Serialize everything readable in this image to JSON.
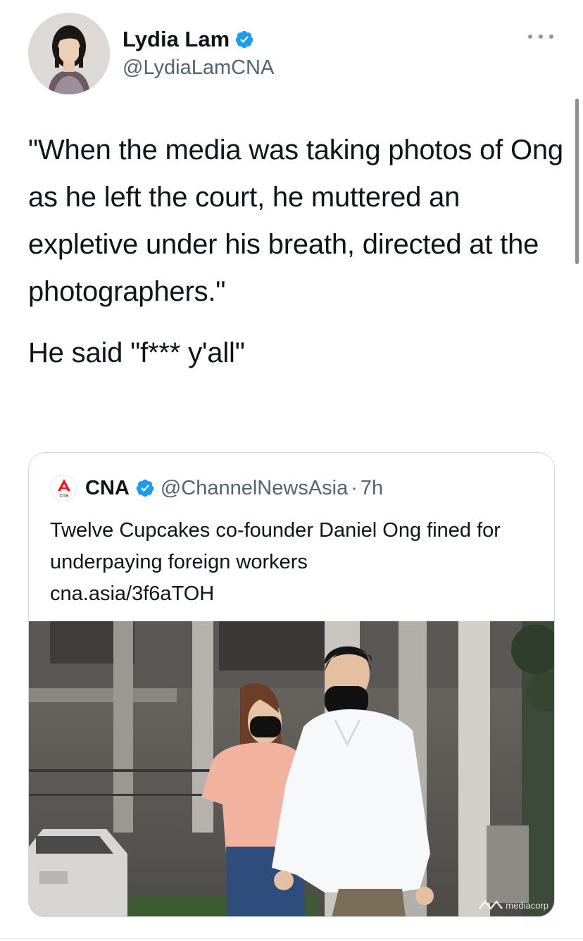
{
  "author": {
    "display_name": "Lydia Lam",
    "handle": "@LydiaLamCNA",
    "verified": true,
    "avatar_icon": "user-avatar"
  },
  "tweet": {
    "paragraph_1": "\"When the media was taking photos of Ong as he left the court, he muttered an expletive under his breath, directed at the photographers.\"",
    "paragraph_2": "He said \"f*** y'all\""
  },
  "quoted_tweet": {
    "display_name": "CNA",
    "logo_text": "cna",
    "handle": "@ChannelNewsAsia",
    "separator": "·",
    "time": "7h",
    "text": "Twelve Cupcakes co-founder Daniel Ong fined for underpaying foreign workers",
    "link": "cna.asia/3f6aTOH",
    "image_watermark": "mediacorp"
  },
  "colors": {
    "verified_blue": "#1d9bf0",
    "cna_red": "#e31b23",
    "text_primary": "#0f1419",
    "text_secondary": "#536471",
    "border": "#cfd9de"
  }
}
